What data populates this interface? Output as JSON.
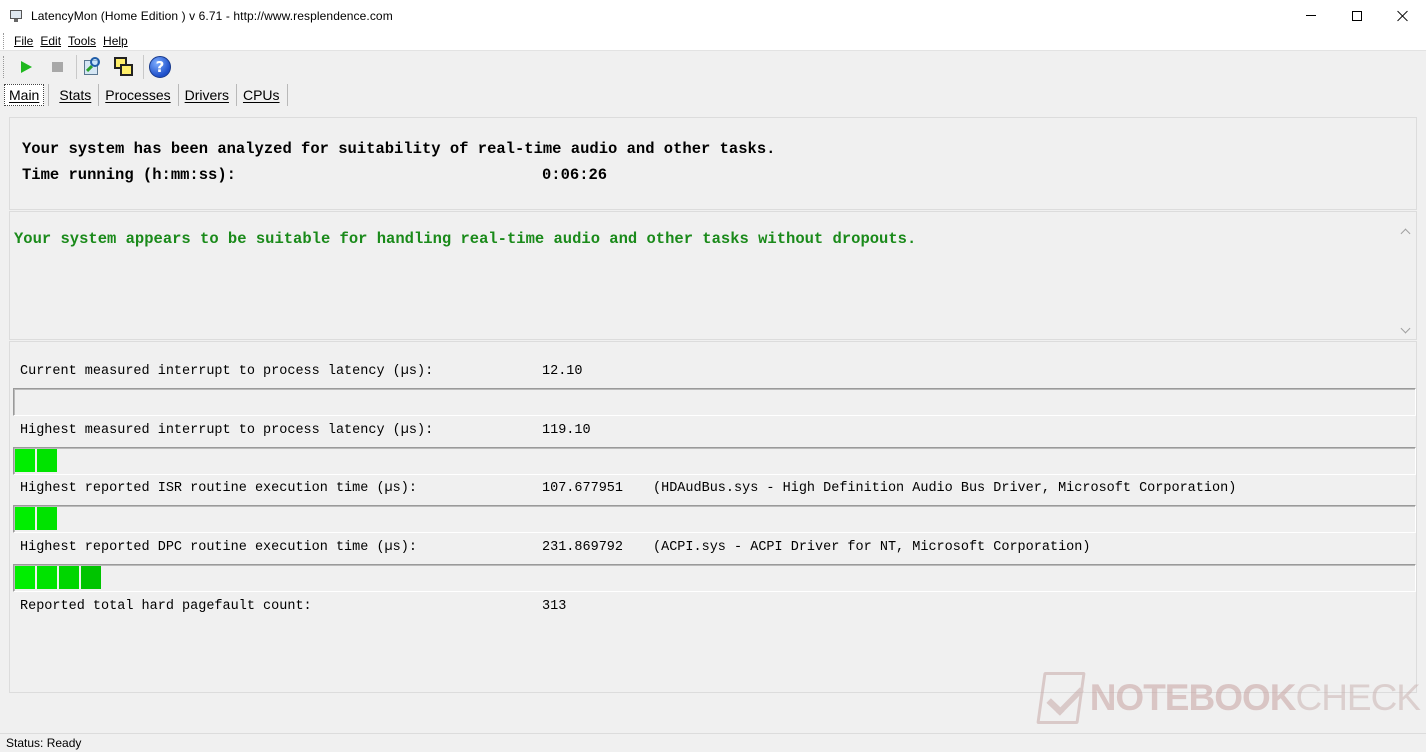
{
  "window": {
    "title": "LatencyMon  (Home Edition )  v 6.71 - http://www.resplendence.com",
    "icon": "monitor-icon"
  },
  "menu": {
    "items": [
      "File",
      "Edit",
      "Tools",
      "Help"
    ]
  },
  "toolbar": {
    "buttons": [
      "play-icon",
      "stop-icon",
      "search-icon",
      "windows-icon",
      "help-icon"
    ]
  },
  "tabs": [
    "Main",
    "Stats",
    "Processes",
    "Drivers",
    "CPUs"
  ],
  "summary": {
    "analyzed_text": "Your system has been analyzed for suitability of real-time audio and other tasks.",
    "time_label": "Time running (h:mm:ss):",
    "time_value": "0:06:26"
  },
  "verdict": {
    "message": "Your system appears to be suitable for handling real-time audio and other tasks without dropouts.",
    "color": "#1a8a1a"
  },
  "metrics": [
    {
      "label": "Current measured interrupt to process latency (µs):",
      "value": "12.10",
      "driver": "",
      "segments": 0
    },
    {
      "label": "Highest measured interrupt to process latency (µs):",
      "value": "119.10",
      "driver": "",
      "segments": 2
    },
    {
      "label": "Highest reported ISR routine execution time (µs):",
      "value": "107.677951",
      "driver": "(HDAudBus.sys - High Definition Audio Bus Driver, Microsoft Corporation)",
      "segments": 2
    },
    {
      "label": "Highest reported DPC routine execution time (µs):",
      "value": "231.869792",
      "driver": "(ACPI.sys - ACPI Driver for NT, Microsoft Corporation)",
      "segments": 4
    },
    {
      "label": "Reported total hard pagefault count:",
      "value": "313",
      "driver": "",
      "segments": 0
    }
  ],
  "bar_colors": [
    "#00ee00",
    "#00e300",
    "#00d600",
    "#00c400"
  ],
  "status": {
    "text": "Status: Ready"
  },
  "watermark": {
    "brand_bold": "NOTEBOOK",
    "brand_light": "CHECK"
  }
}
